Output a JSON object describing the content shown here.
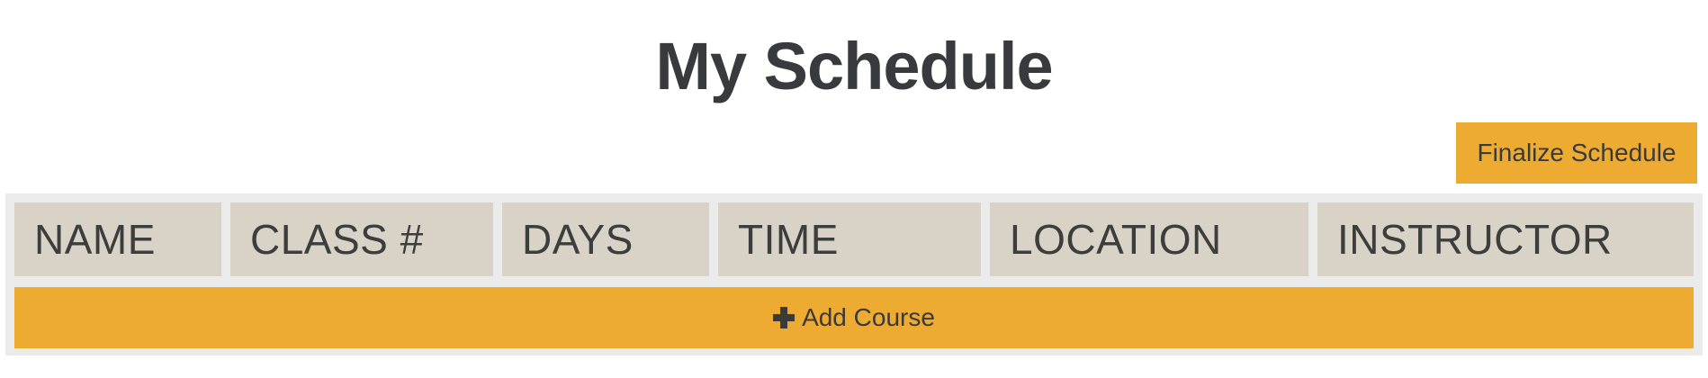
{
  "page": {
    "title": "My Schedule"
  },
  "toolbar": {
    "finalize_label": "Finalize Schedule"
  },
  "table": {
    "columns": [
      {
        "label": "NAME"
      },
      {
        "label": "CLASS #"
      },
      {
        "label": "DAYS"
      },
      {
        "label": "TIME"
      },
      {
        "label": "LOCATION"
      },
      {
        "label": "INSTRUCTOR"
      }
    ],
    "add_course_label": "Add Course",
    "add_course_icon": "plus-icon"
  },
  "colors": {
    "accent": "#edab31",
    "header_cell": "#d8d2c7",
    "table_background": "#ebebeb",
    "text": "#383a3d"
  }
}
